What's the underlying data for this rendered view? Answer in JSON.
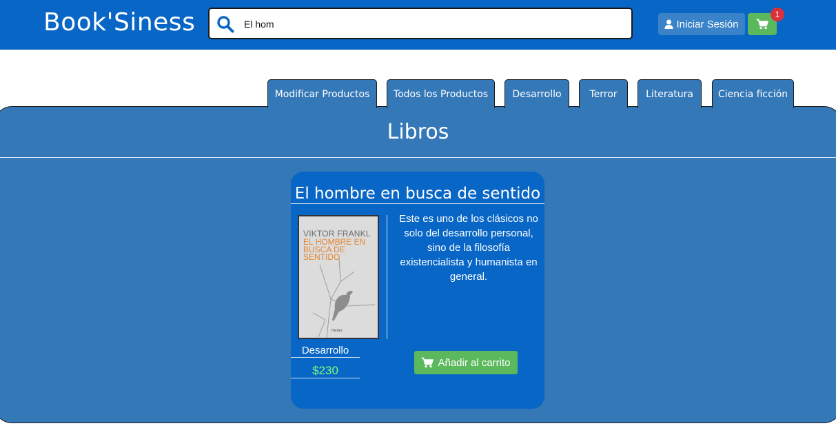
{
  "header": {
    "brand": "Book'Siness",
    "search": {
      "value": "El hom",
      "icon": "search-icon"
    },
    "login_label": "Iniciar Sesión",
    "cart_count": "1",
    "colors": {
      "bar": "#0866c6",
      "login": "#3a83c9",
      "cart": "#5cb85c",
      "badge": "#d9303a"
    }
  },
  "tabs": [
    {
      "label": "Modificar Productos"
    },
    {
      "label": "Todos los Productos"
    },
    {
      "label": "Desarrollo"
    },
    {
      "label": "Terror"
    },
    {
      "label": "Literatura"
    },
    {
      "label": "Ciencia ficción"
    }
  ],
  "main": {
    "title": "Libros",
    "product": {
      "title": "El hombre en busca de sentido",
      "cover_author": "VIKTOR FRANKL",
      "cover_title": "EL HOMBRE EN BUSCA DE SENTIDO",
      "cover_publisher": "Herder",
      "description": "Este es uno de los clásicos no solo del desarrollo personal, sino de la filosofía existencialista y humanista en general.",
      "category": "Desarrollo",
      "price": "$230",
      "add_label": "Añadir al carrito"
    }
  }
}
